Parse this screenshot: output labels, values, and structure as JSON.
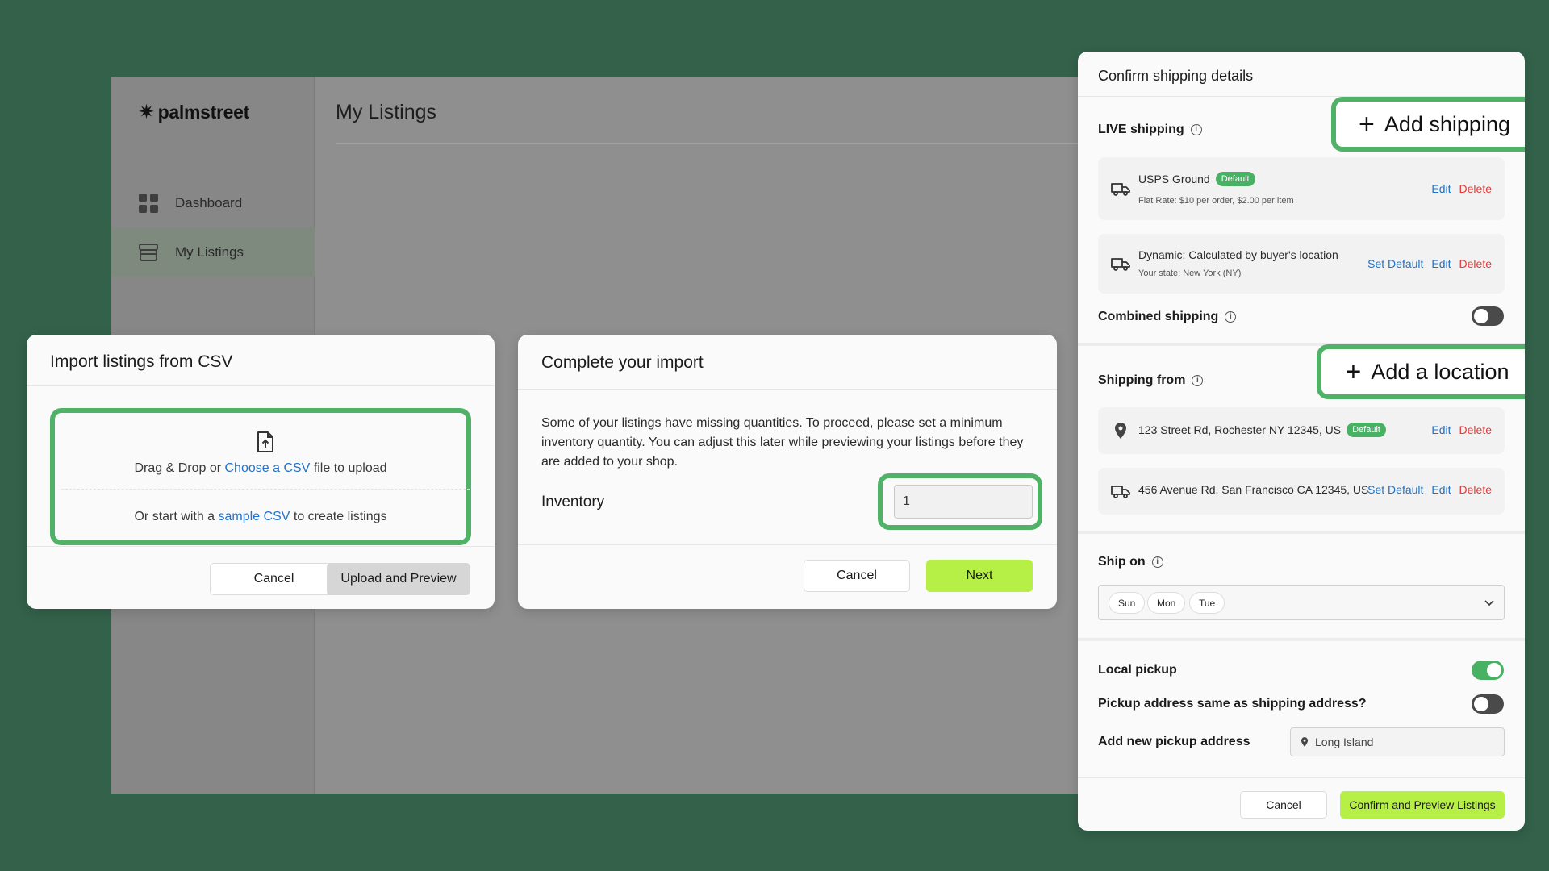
{
  "app": {
    "brand": "palmstreet",
    "nav": [
      {
        "label": "Dashboard",
        "icon": "grid-icon"
      },
      {
        "label": "My Listings",
        "icon": "store-icon"
      }
    ],
    "page_title": "My Listings"
  },
  "import_modal": {
    "title": "Import listings from CSV",
    "drop_prefix": "Drag & Drop or",
    "drop_link": "Choose a CSV",
    "drop_suffix": "file to upload",
    "sample_prefix": "Or start with a",
    "sample_link": "sample CSV",
    "sample_suffix": "to create listings",
    "cancel": "Cancel",
    "upload": "Upload and Preview"
  },
  "complete_modal": {
    "title": "Complete your import",
    "description": "Some of your listings have missing quantities. To proceed, please set a minimum inventory quantity. You can adjust this later while previewing your listings before they are added to your shop.",
    "inventory_label": "Inventory",
    "inventory_value": "1",
    "cancel": "Cancel",
    "next": "Next"
  },
  "shipping_panel": {
    "title": "Confirm shipping details",
    "live_shipping": "LIVE shipping",
    "add_shipping": "Add shipping",
    "methods": [
      {
        "name": "USPS Ground",
        "badge": "Default",
        "detail": "Flat Rate: $10 per order, $2.00 per item",
        "actions": [
          "Edit",
          "Delete"
        ]
      },
      {
        "name": "Dynamic: Calculated by buyer's location",
        "badge": "",
        "detail": "Your state: New York (NY)",
        "actions": [
          "Set Default",
          "Edit",
          "Delete"
        ]
      }
    ],
    "combined_shipping": "Combined shipping",
    "combined_on": false,
    "shipping_from": "Shipping from",
    "add_location": "Add a location",
    "locations": [
      {
        "address": "123 Street Rd, Rochester NY 12345, US",
        "badge": "Default",
        "actions": [
          "Edit",
          "Delete"
        ]
      },
      {
        "address": "456 Avenue Rd, San Francisco CA 12345, US",
        "badge": "",
        "actions": [
          "Set Default",
          "Edit",
          "Delete"
        ]
      }
    ],
    "ship_on": "Ship on",
    "ship_days": [
      "Sun",
      "Mon",
      "Tue"
    ],
    "local_pickup": "Local pickup",
    "local_pickup_on": true,
    "pickup_same": "Pickup address same as shipping address?",
    "pickup_same_on": false,
    "add_pickup": "Add new pickup address",
    "pickup_value": "Long Island",
    "cancel": "Cancel",
    "confirm": "Confirm and Preview Listings"
  },
  "colors": {
    "background": "#33614a",
    "highlight": "#50b266",
    "accent_lime": "#b6ef45",
    "link": "#2273c9",
    "delete": "#e23b3b"
  }
}
